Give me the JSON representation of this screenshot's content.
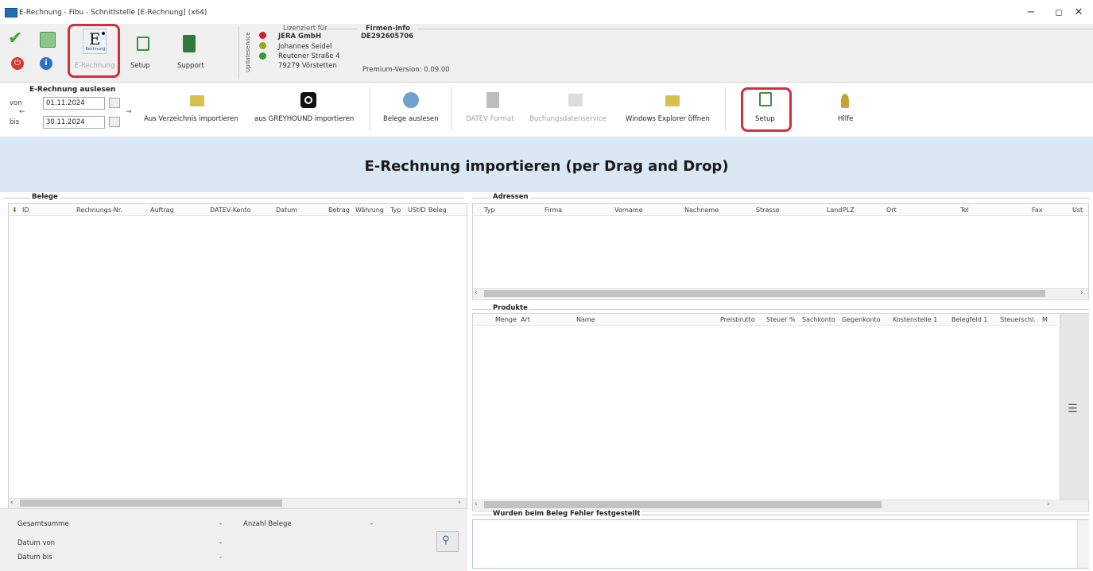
{
  "window": {
    "title": "E-Rechnung - Fibu - Schnittstelle [E-Rechnung] (x64)",
    "min": "−",
    "max": "◻",
    "close": "✕"
  },
  "topbar": {
    "erechnung_glyph": "E",
    "erechnung_sub": "Rechnung",
    "erechnung_label": "E-Rechnung",
    "setup_label": "Setup",
    "support_label": "Support",
    "updateservice_label": "Updateservice",
    "lizenz_heading": "Lizenziert für",
    "lizenz_company": "JERA GmbH",
    "lizenz_name": "Johannes Seidel",
    "lizenz_street": "Reutener Straße 4",
    "lizenz_city": "79279 Vörstetten",
    "firmen_heading": "Firmen-Info",
    "firmen_vat": "DE292605706",
    "version": "Premium-Version: 0.09.00",
    "colors": {
      "check": "#3aa63a",
      "power": "#d23a3a",
      "info": "#2a6fc9",
      "setup": "#3a8c43",
      "support": "#2f7a39"
    },
    "status_dots": [
      "#d82020",
      "#9aa61c",
      "#2e9e2e"
    ]
  },
  "toolbar": {
    "group_title": "E-Rechnung auslesen",
    "von_label": "von",
    "von_value": "01.11.2024",
    "bis_label": "bis",
    "bis_value": "30.11.2024",
    "import_dir": "Aus Verzeichnis importieren",
    "import_greyhound": "aus GREYHOUND importieren",
    "belege_auslesen": "Belege auslesen",
    "datev_format": "DATEV Format",
    "buchungsdaten": "Buchungsdatenservice",
    "explorer": "Windows Explorer öffnen",
    "setup": "Setup",
    "hilfe": "Hilfe"
  },
  "banner": {
    "title": "E-Rechnung importieren (per Drag and Drop)"
  },
  "belege": {
    "title": "Belege",
    "columns": [
      "ID",
      "Rechnungs-Nr.",
      "Auftrag",
      "DATEV-Konto",
      "Datum",
      "Betrag",
      "Währung",
      "Typ",
      "UStID",
      "Beleg"
    ]
  },
  "adressen": {
    "title": "Adressen",
    "columns": [
      "Typ",
      "Firma",
      "Vorname",
      "Nachname",
      "Strasse",
      "Land",
      "PLZ",
      "Ort",
      "Tel",
      "Fax",
      "Ust"
    ]
  },
  "produkte": {
    "title": "Produkte",
    "columns": [
      "Menge",
      "Art",
      "Name",
      "Preisbrutto",
      "Steuer %",
      "Sachkonto",
      "Gegenkonto",
      "Kostenstelle 1",
      "Belegfeld 1",
      "Steuerschl.",
      "M"
    ]
  },
  "fehler": {
    "title": "Wurden beim Beleg Fehler festgestellt"
  },
  "status": {
    "gesamtsumme_label": "Gesamtsumme",
    "gesamtsumme_value": "-",
    "anzahl_label": "Anzahl Belege",
    "anzahl_value": "-",
    "datum_von_label": "Datum von",
    "datum_von_value": "-",
    "datum_bis_label": "Datum bis",
    "datum_bis_value": "-"
  }
}
